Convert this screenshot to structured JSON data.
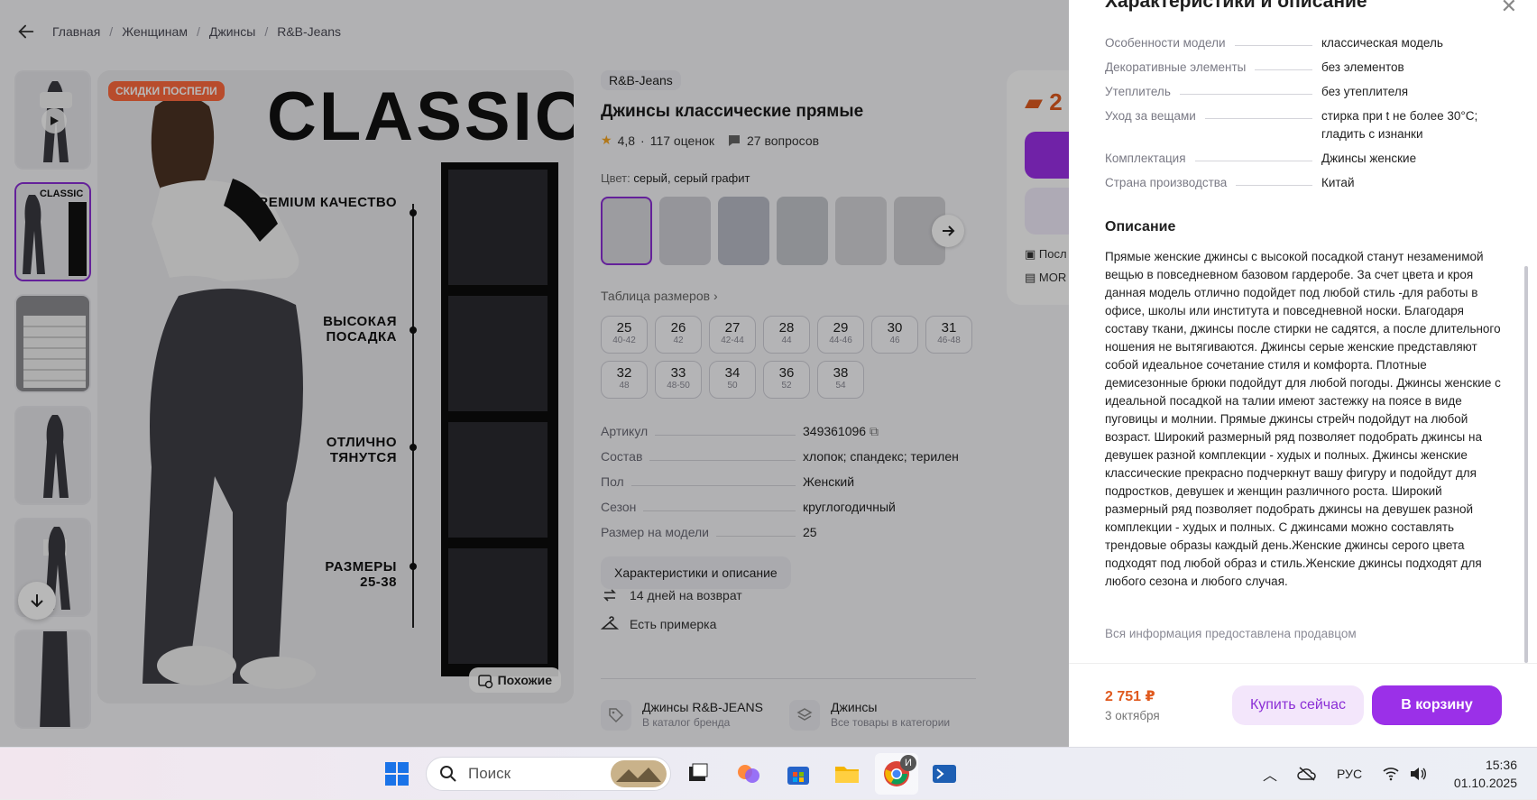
{
  "breadcrumb": [
    "Главная",
    "Женщинам",
    "Джинсы",
    "R&B-Jeans"
  ],
  "main_image": {
    "badge": "СКИДКИ ПОСПЕЛИ",
    "heading": "CLASSIC",
    "features": [
      "PREMIUM КАЧЕСТВО",
      "ВЫСОКАЯ ПОСАДКА",
      "ОТЛИЧНО ТЯНУТСЯ",
      "РАЗМЕРЫ 25-38"
    ],
    "similar_label": "Похожие"
  },
  "product": {
    "brand": "R&B-Jeans",
    "title": "Джинсы классические прямые",
    "rating": "4,8",
    "reviews": "117 оценок",
    "questions": "27 вопросов",
    "color_label": "Цвет:",
    "color_value": "серый, серый графит",
    "size_table": "Таблица размеров",
    "sizes": [
      {
        "n": "25",
        "r": "40-42"
      },
      {
        "n": "26",
        "r": "42"
      },
      {
        "n": "27",
        "r": "42-44"
      },
      {
        "n": "28",
        "r": "44"
      },
      {
        "n": "29",
        "r": "44-46"
      },
      {
        "n": "30",
        "r": "46"
      },
      {
        "n": "31",
        "r": "46-48"
      },
      {
        "n": "32",
        "r": "48"
      },
      {
        "n": "33",
        "r": "48-50"
      },
      {
        "n": "34",
        "r": "50"
      },
      {
        "n": "36",
        "r": "52"
      },
      {
        "n": "38",
        "r": "54"
      }
    ],
    "specs": [
      {
        "k": "Артикул",
        "v": "349361096"
      },
      {
        "k": "Состав",
        "v": "хлопок; спандекс; терилен"
      },
      {
        "k": "Пол",
        "v": "Женский"
      },
      {
        "k": "Сезон",
        "v": "круглогодичный"
      },
      {
        "k": "Размер на модели",
        "v": "25"
      }
    ],
    "chars_button": "Характеристики и описание",
    "perks": [
      "14 дней на возврат",
      "Есть примерка"
    ],
    "brand_link": {
      "t1": "Джинсы R&B-JEANS",
      "t2": "В каталог бренда"
    },
    "category_link": {
      "t1": "Джинсы",
      "t2": "Все товары в категории"
    }
  },
  "price_card": {
    "price_partial": "2",
    "line1": "Посл",
    "line2": "MOR"
  },
  "panel": {
    "heading": "Характеристики и описание",
    "chars": [
      {
        "k": "Особенности модели",
        "v": "классическая модель"
      },
      {
        "k": "Декоративные элементы",
        "v": "без элементов"
      },
      {
        "k": "Утеплитель",
        "v": "без утеплителя"
      },
      {
        "k": "Уход за вещами",
        "v": "стирка при t не более 30°С; гладить с изнанки"
      },
      {
        "k": "Комплектация",
        "v": "Джинсы женские"
      },
      {
        "k": "Страна производства",
        "v": "Китай"
      }
    ],
    "desc_title": "Описание",
    "description": "Прямые женские джинсы с высокой посадкой станут незаменимой вещью в повседневном базовом гардеробе. За счет цвета и кроя данная модель отлично подойдет под любой стиль -для работы в офисе, школы или института и повседневной носки. Благодаря составу ткани, джинсы после стирки не садятся, а после длительного ношения не вытягиваются. Джинсы серые женские представляют собой идеальное сочетание стиля и комфорта. Плотные демисезонные брюки подойдут для любой погоды. Джинсы женские с идеальной посадкой на талии имеют застежку на поясе в виде пуговицы и молнии. Прямые джинсы стрейч подойдут на любой возраст. Широкий размерный ряд позволяет подобрать джинсы на девушек разной комплекции - худых и полных. Джинсы женские классические прекрасно подчеркнут вашу фигуру и подойдут для подростков, девушек и женщин различного роста. Широкий размерный ряд позволяет подобрать джинсы на девушек разной комплекции - худых и полных. С джинсами можно составлять трендовые образы каждый день.Женские джинсы серого цвета подходят под любой образ и стиль.Женские джинсы подходят для любого сезона и любого случая.",
    "seller_note": "Вся информация предоставлена продавцом",
    "price": "2 751 ₽",
    "delivery": "3 октября",
    "buy_now": "Купить сейчас",
    "to_cart": "В корзину"
  },
  "taskbar": {
    "search_placeholder": "Поиск",
    "language": "РУС",
    "time": "15:36",
    "date": "01.10.2025",
    "chrome_badge": "И"
  },
  "colors": {
    "accent": "#9b30e8",
    "price": "#e05a1f",
    "sale_badge": "#ff6a3d"
  }
}
